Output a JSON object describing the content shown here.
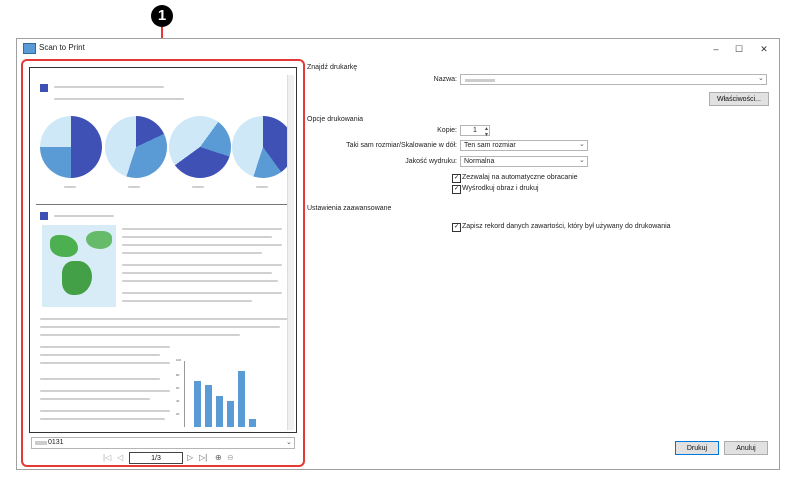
{
  "callout": "1",
  "window": {
    "title": "Scan to Print",
    "minimize": "–",
    "maximize": "☐",
    "close": "✕"
  },
  "preview": {
    "file_selected": "0131",
    "page": "1/3",
    "chart_ticks": [
      "100",
      "80",
      "60",
      "40",
      "20"
    ]
  },
  "printer": {
    "section": "Znajdź drukarkę",
    "name_label": "Nazwa:",
    "properties_button": "Właściwości..."
  },
  "options": {
    "section": "Opcje drukowania",
    "copies_label": "Kopie:",
    "copies_value": "1",
    "scaling_label": "Taki sam rozmiar/Skalowanie w dół:",
    "scaling_value": "Ten sam rozmiar",
    "quality_label": "Jakość wydruku:",
    "quality_value": "Normalna",
    "auto_rotate": "Zezwalaj na automatyczne obracanie",
    "center_image": "Wyśrodkuj obraz i drukuj"
  },
  "advanced": {
    "section": "Ustawienia zaawansowane",
    "save_record": "Zapisz rekord danych zawartości, który był używany do drukowania"
  },
  "actions": {
    "print": "Drukuj",
    "cancel": "Anuluj"
  },
  "colors": {
    "accent": "#e53935",
    "chart_dark": "#3f51b5",
    "chart_light": "#5b9bd5",
    "chart_pale": "#cfe8f7",
    "map_green": "#4caf50"
  }
}
